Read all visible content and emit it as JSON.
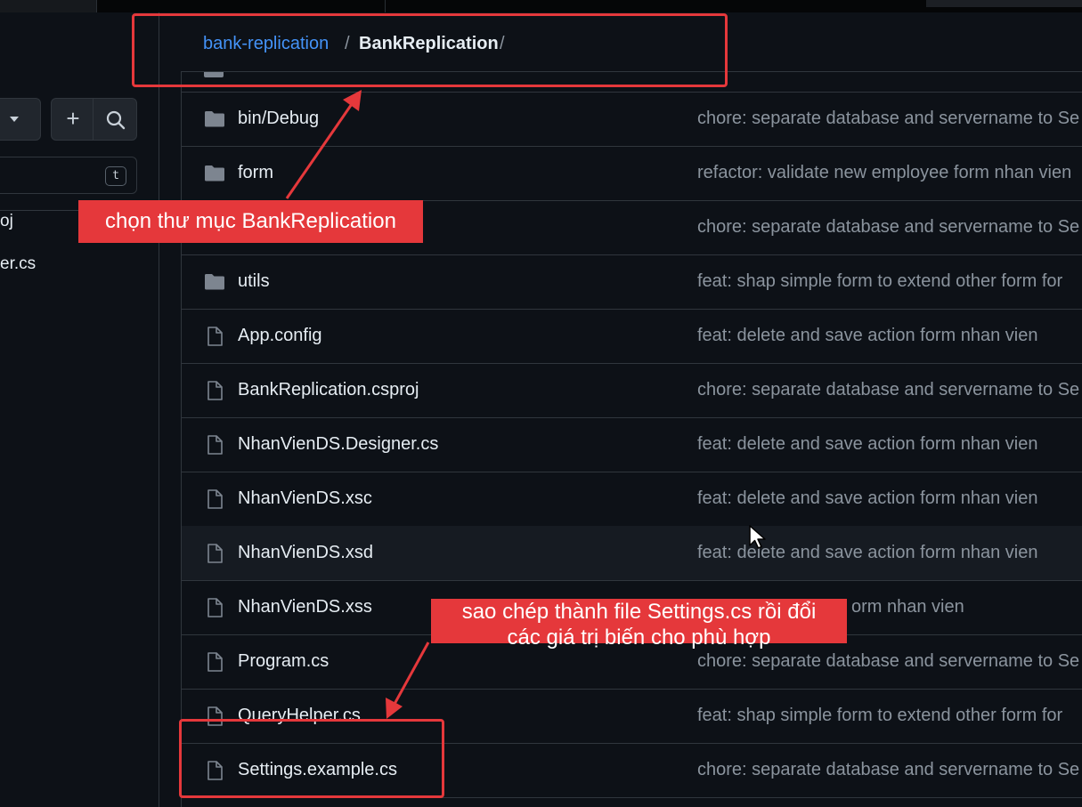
{
  "sidebar": {
    "shortcut_key": "t",
    "items": [
      "oj",
      "er.cs"
    ]
  },
  "breadcrumb": {
    "repo": "bank-replication",
    "separator": "/",
    "current": "BankReplication",
    "trailing": "/"
  },
  "files": [
    {
      "type": "folder",
      "name": "bin/Debug",
      "message": "chore: separate database and servername to Se"
    },
    {
      "type": "folder",
      "name": "form",
      "message": "refactor: validate new employee form nhan vien"
    },
    {
      "type": "folder",
      "name": "",
      "message": "chore: separate database and servername to Se"
    },
    {
      "type": "folder",
      "name": "utils",
      "message": "feat: shap simple form to extend other form for"
    },
    {
      "type": "file",
      "name": "App.config",
      "message": "feat: delete and save action form nhan vien"
    },
    {
      "type": "file",
      "name": "BankReplication.csproj",
      "message": "chore: separate database and servername to Se"
    },
    {
      "type": "file",
      "name": "NhanVienDS.Designer.cs",
      "message": "feat: delete and save action form nhan vien"
    },
    {
      "type": "file",
      "name": "NhanVienDS.xsc",
      "message": "feat: delete and save action form nhan vien"
    },
    {
      "type": "file",
      "name": "NhanVienDS.xsd",
      "message": "feat: delete and save action form nhan vien"
    },
    {
      "type": "file",
      "name": "NhanVienDS.xss",
      "message": "orm nhan vien"
    },
    {
      "type": "file",
      "name": "Program.cs",
      "message": "chore: separate database and servername to Se"
    },
    {
      "type": "file",
      "name": "QueryHelper.cs",
      "message": "feat: shap simple form to extend other form for"
    },
    {
      "type": "file",
      "name": "Settings.example.cs",
      "message": "chore: separate database and servername to Se"
    }
  ],
  "annotations": {
    "top": "chọn thư mục BankReplication",
    "bottom_line1": "sao chép thành file Settings.cs rồi đổi",
    "bottom_line2": "các giá trị biến cho phù hợp"
  },
  "colors": {
    "background": "#0d1117",
    "link": "#4493f8",
    "muted_text": "#8b949e",
    "annotation_red": "#e5383b"
  }
}
